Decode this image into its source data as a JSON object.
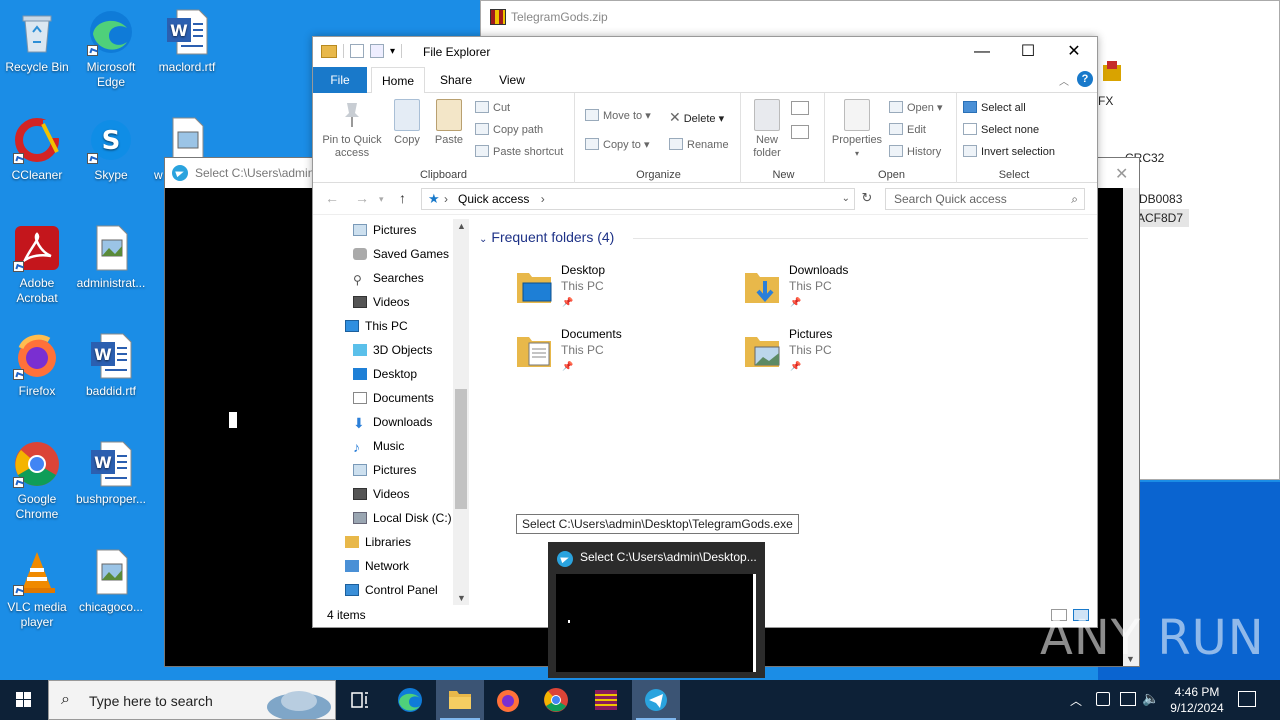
{
  "desktop": {
    "icons": [
      {
        "label": "Recycle Bin"
      },
      {
        "label": "Microsoft Edge"
      },
      {
        "label": "maclord.rtf"
      },
      {
        "label": "CCleaner"
      },
      {
        "label": "Skype"
      },
      {
        "label": "w"
      },
      {
        "label": "Adobe Acrobat"
      },
      {
        "label": "administrat..."
      },
      {
        "label": "Firefox"
      },
      {
        "label": "baddid.rtf"
      },
      {
        "label": "Google Chrome"
      },
      {
        "label": "bushproper..."
      },
      {
        "label": "VLC media player"
      },
      {
        "label": "chicagoco..."
      }
    ]
  },
  "zip_window": {
    "title": "TelegramGods.zip",
    "col_header": "CRC32",
    "val1": "DB0083",
    "val2": "ACF8D7",
    "fx": "FX"
  },
  "console_window": {
    "title": "Select C:\\Users\\admin\\"
  },
  "explorer": {
    "title": "File Explorer",
    "tabs": [
      "File",
      "Home",
      "Share",
      "View"
    ],
    "ribbon": {
      "clipboard": {
        "pin": "Pin to Quick access",
        "copy": "Copy",
        "paste": "Paste",
        "cut": "Cut",
        "copy_path": "Copy path",
        "paste_shortcut": "Paste shortcut",
        "label": "Clipboard"
      },
      "organize": {
        "move_to": "Move to",
        "copy_to": "Copy to",
        "delete": "Delete",
        "rename": "Rename",
        "label": "Organize"
      },
      "new": {
        "new_folder": "New folder",
        "label": "New"
      },
      "open": {
        "properties": "Properties",
        "open": "Open",
        "edit": "Edit",
        "history": "History",
        "label": "Open"
      },
      "select": {
        "select_all": "Select all",
        "select_none": "Select none",
        "invert": "Invert selection",
        "label": "Select"
      }
    },
    "address": {
      "path": "Quick access",
      "search_placeholder": "Search Quick access"
    },
    "nav": [
      "Pictures",
      "Saved Games",
      "Searches",
      "Videos",
      "This PC",
      "3D Objects",
      "Desktop",
      "Documents",
      "Downloads",
      "Music",
      "Pictures",
      "Videos",
      "Local Disk (C:)",
      "Libraries",
      "Network",
      "Control Panel"
    ],
    "section": "Frequent folders (4)",
    "folders": [
      {
        "name": "Desktop",
        "sub": "This PC"
      },
      {
        "name": "Downloads",
        "sub": "This PC"
      },
      {
        "name": "Documents",
        "sub": "This PC"
      },
      {
        "name": "Pictures",
        "sub": "This PC"
      }
    ],
    "status": "4 items"
  },
  "tooltip": "Select C:\\Users\\admin\\Desktop\\TelegramGods.exe",
  "thumbnail": {
    "title": "Select C:\\Users\\admin\\Desktop..."
  },
  "taskbar": {
    "search_placeholder": "Type here to search",
    "time": "4:46 PM",
    "date": "9/12/2024"
  },
  "watermark": "ANY RUN"
}
